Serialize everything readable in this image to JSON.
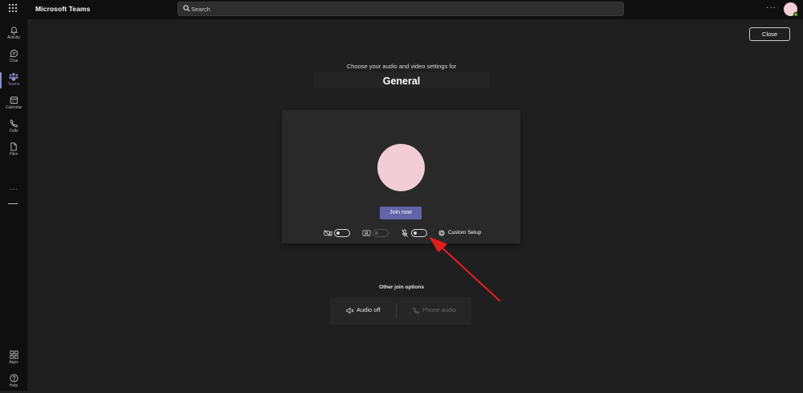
{
  "app": {
    "title": "Microsoft Teams"
  },
  "search": {
    "placeholder": "Search"
  },
  "rail": {
    "items": [
      {
        "label": "Activity",
        "icon": "bell-icon"
      },
      {
        "label": "Chat",
        "icon": "chat-icon"
      },
      {
        "label": "Teams",
        "icon": "teams-icon",
        "active": true
      },
      {
        "label": "Calendar",
        "icon": "calendar-icon"
      },
      {
        "label": "Calls",
        "icon": "phone-icon"
      },
      {
        "label": "Files",
        "icon": "file-icon"
      }
    ],
    "more": "···",
    "bottom": [
      {
        "label": "Apps",
        "icon": "apps-icon"
      },
      {
        "label": "Help",
        "icon": "help-icon"
      }
    ]
  },
  "header": {
    "close_label": "Close"
  },
  "prejoin": {
    "subtitle": "Choose your audio and video settings for",
    "channel": "General",
    "join_label": "Join now",
    "controls": {
      "camera": {
        "icon": "camera-off-icon",
        "on": false
      },
      "background": {
        "icon": "background-effects-icon",
        "enabled": false
      },
      "mic": {
        "icon": "mic-off-icon",
        "on": false
      },
      "custom_setup_label": "Custom Setup"
    }
  },
  "other": {
    "title": "Other join options",
    "audio_off": "Audio off",
    "phone_audio": "Phone audio"
  },
  "colors": {
    "accent": "#6264a7",
    "avatar": "#f2cdd7",
    "annotation_arrow": "#e01e1e",
    "presence": "#6bb700"
  }
}
